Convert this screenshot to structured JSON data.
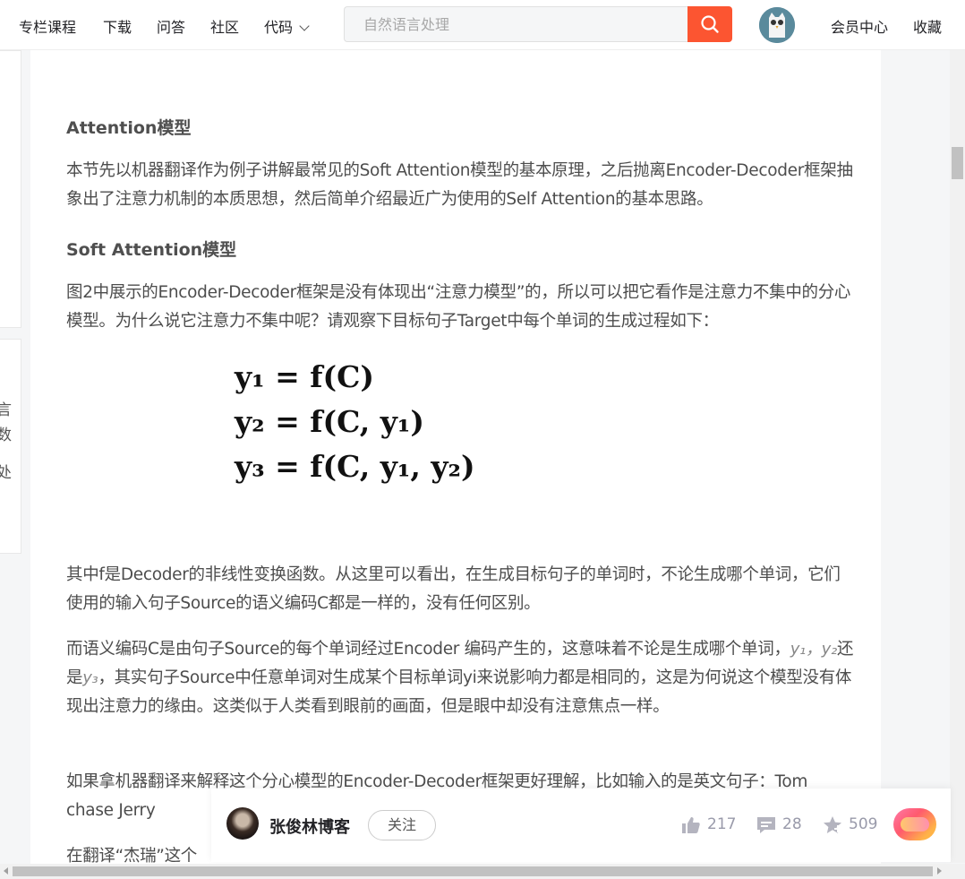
{
  "nav": {
    "items": [
      "专栏课程",
      "下载",
      "问答",
      "社区"
    ],
    "code_label": "代码",
    "search_placeholder": "自然语言处理",
    "member_center": "会员中心",
    "favorites": "收藏"
  },
  "sidebar": {
    "chars": [
      "言",
      "数",
      "处"
    ]
  },
  "article": {
    "heading1": "Attention模型",
    "para1": "本节先以机器翻译作为例子讲解最常见的Soft Attention模型的基本原理，之后抛离Encoder-Decoder框架抽象出了注意力机制的本质思想，然后简单介绍最近广为使用的Self Attention的基本思路。",
    "heading2": "Soft Attention模型",
    "para2": "图2中展示的Encoder-Decoder框架是没有体现出“注意力模型”的，所以可以把它看作是注意力不集中的分心模型。为什么说它注意力不集中呢？请观察下目标句子Target中每个单词的生成过程如下：",
    "formula": {
      "line1": "y₁ = f(C)",
      "line2": "y₂ = f(C, y₁)",
      "line3": "y₃ = f(C, y₁, y₂)"
    },
    "para3": "其中f是Decoder的非线性变换函数。从这里可以看出，在生成目标句子的单词时，不论生成哪个单词，它们使用的输入句子Source的语义编码C都是一样的，没有任何区别。",
    "para4_a": "而语义编码C是由句子Source的每个单词经过Encoder 编码产生的，这意味着不论是生成哪个单词，",
    "para4_y1": "y₁，y₂",
    "para4_mid": "还是",
    "para4_y3": "y₃",
    "para4_b": "，其实句子Source中任意单词对生成某个目标单词yi来说影响力都是相同的，这是为何说这个模型没有体现出注意力的缘由。这类似于人类看到眼前的画面，但是眼中却没有注意焦点一样。",
    "para5": "如果拿机器翻译来解释这个分心模型的Encoder-Decoder框架更好理解，比如输入的是英文句子：Tom chase Jerry",
    "para6": "在翻译“杰瑞”这个"
  },
  "toolbar": {
    "author": "张俊林博客",
    "follow": "关注",
    "likes": "217",
    "comments": "28",
    "favorites": "509"
  },
  "colors": {
    "search_button": "#fc5531",
    "text": "#4d4d4d"
  }
}
